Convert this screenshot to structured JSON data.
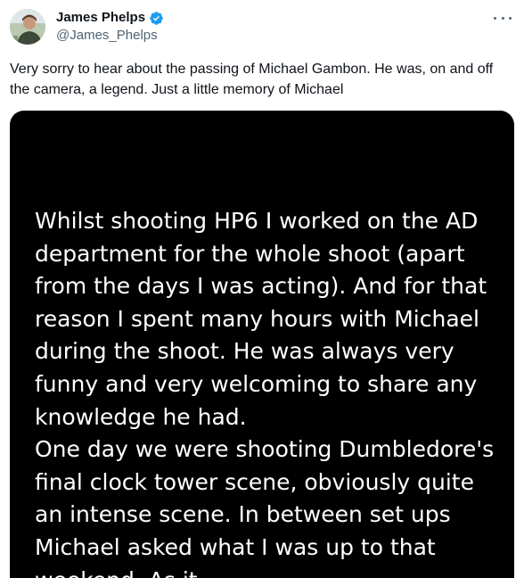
{
  "author": {
    "display_name": "James Phelps",
    "handle": "@James_Phelps",
    "verified_icon": "verified-badge-icon",
    "avatar_icon": "avatar"
  },
  "colors": {
    "verified_blue": "#1d9bf0",
    "text_primary": "#0f1419",
    "text_secondary": "#536471",
    "media_background": "#000000"
  },
  "tweet": {
    "text": "Very sorry to hear about the passing of Michael Gambon. He was, on and off the camera, a legend. Just a little memory of Michael"
  },
  "media": {
    "image_text": "Whilst shooting HP6 I worked on the AD department for the whole shoot (apart from the days I was acting). And for that reason I spent many hours with Michael during the shoot. He was always very funny and very welcoming to share any knowledge he had.\nOne day we were shooting Dumbledore's final clock tower scene, obviously quite an intense scene. In between set ups Michael asked what I was up to that weekend. As it"
  },
  "menu": {
    "more_icon": "more-options-icon"
  }
}
